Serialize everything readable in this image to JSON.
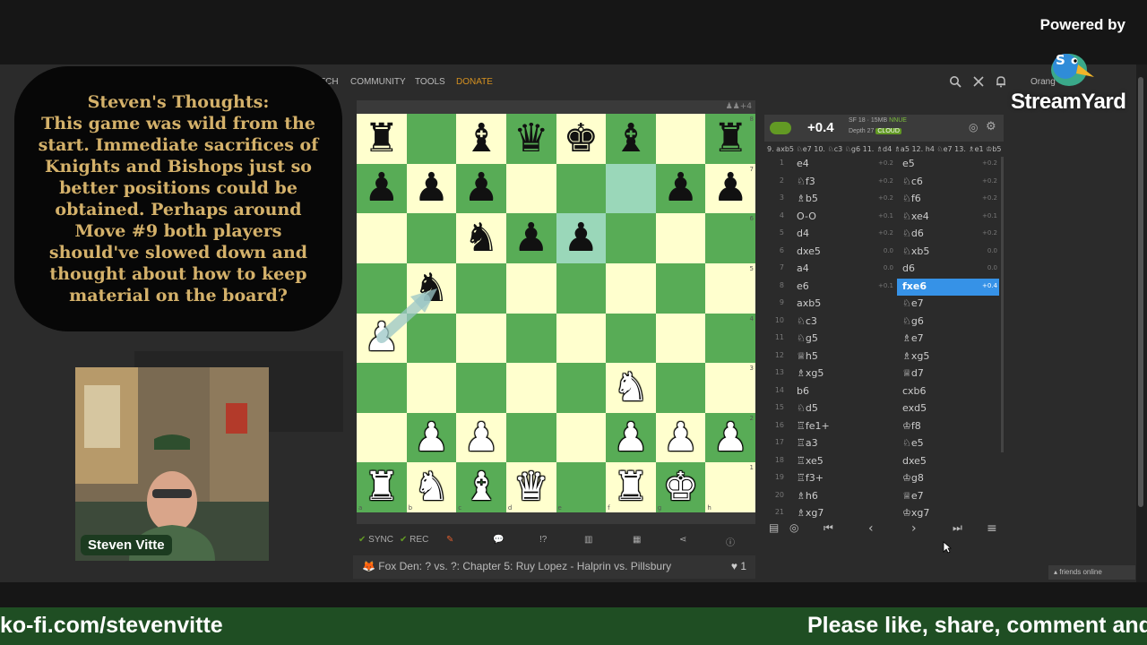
{
  "stream": {
    "powered_by": "Powered by",
    "brand": "StreamYard",
    "thoughts": "Steven's Thoughts:\nThis game was wild from the start. Immediate sacrifices of Knights and Bishops just so better positions could be obtained. Perhaps around Move #9 both players should've slowed down and thought about how to keep material on the board?",
    "cam_name": "Steven Vitte",
    "ticker_left": "ko-fi.com/stevenvitte",
    "ticker_right": "Please like, share, comment and"
  },
  "site": {
    "nav": {
      "watch": "WATCH",
      "community": "COMMUNITY",
      "tools": "TOOLS",
      "donate": "DONATE"
    },
    "user": "Orang",
    "icons": {
      "search": "search-icon",
      "swords": "swords-icon",
      "bell": "bell-icon"
    },
    "friends": "▴ friends online"
  },
  "board": {
    "files": [
      "a",
      "b",
      "c",
      "d",
      "e",
      "f",
      "g",
      "h"
    ],
    "ranks": [
      "8",
      "7",
      "6",
      "5",
      "4",
      "3",
      "2",
      "1"
    ],
    "rows": [
      [
        "r",
        "",
        "b",
        "q",
        "k",
        "b",
        "",
        "r"
      ],
      [
        "p",
        "p",
        "p",
        "",
        "",
        "",
        "p",
        "p"
      ],
      [
        "",
        "",
        "n",
        "p",
        "p",
        "",
        "",
        ""
      ],
      [
        "",
        "n",
        "",
        "",
        "",
        "",
        "",
        ""
      ],
      [
        "P",
        "",
        "",
        "",
        "",
        "",
        "",
        ""
      ],
      [
        "",
        "",
        "",
        "",
        "",
        "N",
        "",
        ""
      ],
      [
        "",
        "P",
        "P",
        "",
        "",
        "P",
        "P",
        "P"
      ],
      [
        "R",
        "N",
        "B",
        "Q",
        "",
        "R",
        "K",
        ""
      ]
    ],
    "highlighted": [
      "f7",
      "e6"
    ],
    "arrow": {
      "from": "a4",
      "to": "b5",
      "color": "#9ac6c6"
    }
  },
  "study": {
    "sync": "SYNC",
    "rec": "REC",
    "chapter": "Fox Den: ? vs. ?: Chapter 5: Ruy Lopez - Halprin vs. Pillsbury",
    "likes": "1"
  },
  "engine": {
    "score": "+0.4",
    "engine": "SF 18 · 15MB",
    "nnue": "NNUE",
    "depth": "Depth 27",
    "cloud": "CLOUD",
    "pv": "9. axb5 ♘e7 10. ♘c3 ♘g6 11. ♗d4 ♗a5 12. h4 ♘e7 13. ♗e1 ♔b5"
  },
  "moves": [
    {
      "n": "1",
      "w": "e4",
      "ws": "+0.2",
      "b": "e5",
      "bs": "+0.2"
    },
    {
      "n": "2",
      "w": "♘f3",
      "ws": "+0.2",
      "b": "♘c6",
      "bs": "+0.2"
    },
    {
      "n": "3",
      "w": "♗b5",
      "ws": "+0.2",
      "b": "♘f6",
      "bs": "+0.2"
    },
    {
      "n": "4",
      "w": "O-O",
      "ws": "+0.1",
      "b": "♘xe4",
      "bs": "+0.1"
    },
    {
      "n": "5",
      "w": "d4",
      "ws": "+0.2",
      "b": "♘d6",
      "bs": "+0.2"
    },
    {
      "n": "6",
      "w": "dxe5",
      "ws": "0.0",
      "b": "♘xb5",
      "bs": "0.0"
    },
    {
      "n": "7",
      "w": "a4",
      "ws": "0.0",
      "b": "d6",
      "bs": "0.0"
    },
    {
      "n": "8",
      "w": "e6",
      "ws": "+0.1",
      "b": "fxe6",
      "bs": "+0.4"
    },
    {
      "n": "9",
      "w": "axb5",
      "ws": "",
      "b": "♘e7",
      "bs": ""
    },
    {
      "n": "10",
      "w": "♘c3",
      "ws": "",
      "b": "♘g6",
      "bs": ""
    },
    {
      "n": "11",
      "w": "♘g5",
      "ws": "",
      "b": "♗e7",
      "bs": ""
    },
    {
      "n": "12",
      "w": "♕h5",
      "ws": "",
      "b": "♗xg5",
      "bs": ""
    },
    {
      "n": "13",
      "w": "♗xg5",
      "ws": "",
      "b": "♕d7",
      "bs": ""
    },
    {
      "n": "14",
      "w": "b6",
      "ws": "",
      "b": "cxb6",
      "bs": ""
    },
    {
      "n": "15",
      "w": "♘d5",
      "ws": "",
      "b": "exd5",
      "bs": ""
    },
    {
      "n": "16",
      "w": "♖fe1+",
      "ws": "",
      "b": "♔f8",
      "bs": ""
    },
    {
      "n": "17",
      "w": "♖a3",
      "ws": "",
      "b": "♘e5",
      "bs": ""
    },
    {
      "n": "18",
      "w": "♖xe5",
      "ws": "",
      "b": "dxe5",
      "bs": ""
    },
    {
      "n": "19",
      "w": "♖f3+",
      "ws": "",
      "b": "♔g8",
      "bs": ""
    },
    {
      "n": "20",
      "w": "♗h6",
      "ws": "",
      "b": "♕e7",
      "bs": ""
    },
    {
      "n": "21",
      "w": "♗xg7",
      "ws": "",
      "b": "♔xg7",
      "bs": ""
    }
  ],
  "active_move": 7
}
